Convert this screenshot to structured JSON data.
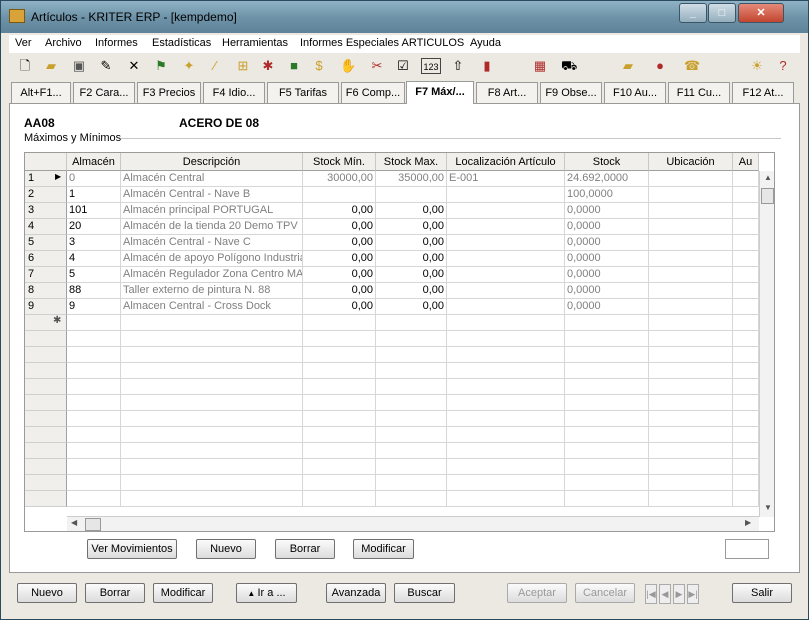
{
  "window": {
    "title": "Artículos - KRITER ERP - [kempdemo]"
  },
  "menu": [
    "Ver",
    "Archivo",
    "Informes",
    "Estadísticas",
    "Herramientas",
    "Informes Especiales ARTICULOS",
    "Ayuda"
  ],
  "tabs": [
    "Alt+F1...",
    "F2 Cara...",
    "F3 Precios",
    "F4 Idio...",
    "F5 Tarifas",
    "F6 Comp...",
    "F7 Máx/...",
    "F8 Art...",
    "F9 Obse...",
    "F10 Au...",
    "F11 Cu...",
    "F12 At..."
  ],
  "article": {
    "code": "AA08",
    "description": "ACERO DE 08"
  },
  "section_title": "Máximos y Mínimos",
  "grid": {
    "columns": [
      "Almacén",
      "Descripción",
      "Stock Mín.",
      "Stock Max.",
      "Localización Artículo",
      "Stock",
      "Ubicación",
      "Au"
    ],
    "rows": [
      {
        "n": "1",
        "almacen": "0",
        "desc": "Almacén Central",
        "min": "30000,00",
        "max": "35000,00",
        "loc": "E-001",
        "stock": "24.692,0000"
      },
      {
        "n": "2",
        "almacen": "1",
        "desc": "Almacén Central - Nave B",
        "min": "",
        "max": "",
        "loc": "",
        "stock": "100,0000"
      },
      {
        "n": "3",
        "almacen": "101",
        "desc": "Almacén principal PORTUGAL",
        "min": "0,00",
        "max": "0,00",
        "loc": "",
        "stock": "0,0000"
      },
      {
        "n": "4",
        "almacen": "20",
        "desc": "Almacén de la tienda 20 Demo TPV",
        "min": "0,00",
        "max": "0,00",
        "loc": "",
        "stock": "0,0000"
      },
      {
        "n": "5",
        "almacen": "3",
        "desc": "Almacén Central - Nave C",
        "min": "0,00",
        "max": "0,00",
        "loc": "",
        "stock": "0,0000"
      },
      {
        "n": "6",
        "almacen": "4",
        "desc": "Almacén de apoyo Polígono Industrial",
        "min": "0,00",
        "max": "0,00",
        "loc": "",
        "stock": "0,0000"
      },
      {
        "n": "7",
        "almacen": "5",
        "desc": "Almacén Regulador Zona Centro MAD",
        "min": "0,00",
        "max": "0,00",
        "loc": "",
        "stock": "0,0000"
      },
      {
        "n": "8",
        "almacen": "88",
        "desc": "Taller externo de pintura N. 88",
        "min": "0,00",
        "max": "0,00",
        "loc": "",
        "stock": "0,0000"
      },
      {
        "n": "9",
        "almacen": "9",
        "desc": "Almacen Central - Cross Dock",
        "min": "0,00",
        "max": "0,00",
        "loc": "",
        "stock": "0,0000"
      }
    ]
  },
  "grid_buttons": {
    "movimientos": "Ver Movimientos",
    "nuevo": "Nuevo",
    "borrar": "Borrar",
    "modificar": "Modificar"
  },
  "footer_buttons": {
    "nuevo": "Nuevo",
    "borrar": "Borrar",
    "modificar": "Modificar",
    "ira": "Ir a ...",
    "avanzada": "Avanzada",
    "buscar": "Buscar",
    "aceptar": "Aceptar",
    "cancelar": "Cancelar",
    "salir": "Salir"
  }
}
